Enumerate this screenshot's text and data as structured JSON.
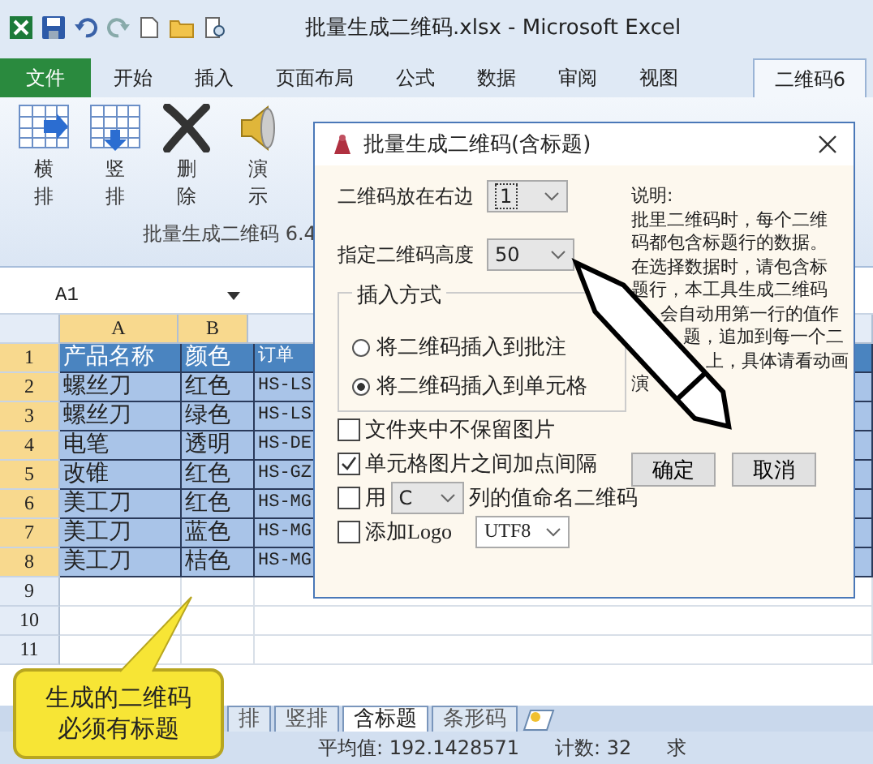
{
  "window": {
    "title": "批量生成二维码.xlsx - Microsoft Excel"
  },
  "ribbon_tabs": [
    {
      "label": "文件",
      "kind": "file",
      "selected": false
    },
    {
      "label": "开始",
      "kind": "tab",
      "selected": false
    },
    {
      "label": "插入",
      "kind": "tab",
      "selected": false
    },
    {
      "label": "页面布局",
      "kind": "tab",
      "selected": false
    },
    {
      "label": "公式",
      "kind": "tab",
      "selected": false
    },
    {
      "label": "数据",
      "kind": "tab",
      "selected": false
    },
    {
      "label": "审阅",
      "kind": "tab",
      "selected": false
    },
    {
      "label": "视图",
      "kind": "tab",
      "selected": false
    },
    {
      "label": "二维码6",
      "kind": "tab",
      "selected": true
    }
  ],
  "ribbon_buttons": [
    {
      "label": "横排",
      "kind": "grid-right"
    },
    {
      "label": "竖排",
      "kind": "grid-down"
    },
    {
      "label": "删除",
      "kind": "cross"
    },
    {
      "label": "演示",
      "kind": "speaker"
    }
  ],
  "ribbon_group": "批量生成二维码 6.4",
  "name_box": "A1",
  "columns": [
    {
      "label": "A",
      "selected": true
    },
    {
      "label": "B",
      "selected": true
    }
  ],
  "rows": [
    {
      "num": "1",
      "kind": "header",
      "cells": [
        "产品名称",
        "颜色",
        "订单"
      ]
    },
    {
      "num": "2",
      "kind": "data",
      "cells": [
        "螺丝刀",
        "红色",
        "HS-LS"
      ]
    },
    {
      "num": "3",
      "kind": "data",
      "cells": [
        "螺丝刀",
        "绿色",
        "HS-LS"
      ]
    },
    {
      "num": "4",
      "kind": "data",
      "cells": [
        "电笔",
        "透明",
        "HS-DE"
      ]
    },
    {
      "num": "5",
      "kind": "data",
      "cells": [
        "改锥",
        "红色",
        "HS-GZ"
      ]
    },
    {
      "num": "6",
      "kind": "data",
      "cells": [
        "美工刀",
        "红色",
        "HS-MG"
      ]
    },
    {
      "num": "7",
      "kind": "data",
      "cells": [
        "美工刀",
        "蓝色",
        "HS-MG"
      ]
    },
    {
      "num": "8",
      "kind": "data",
      "cells": [
        "美工刀",
        "桔色",
        "HS-MG"
      ]
    },
    {
      "num": "9",
      "kind": "empty",
      "cells": []
    },
    {
      "num": "10",
      "kind": "empty",
      "cells": []
    },
    {
      "num": "11",
      "kind": "empty",
      "cells": []
    }
  ],
  "sheet_tabs": [
    {
      "label": "排",
      "selected": false
    },
    {
      "label": "竖排",
      "selected": false
    },
    {
      "label": "含标题",
      "selected": true
    },
    {
      "label": "条形码",
      "selected": false
    }
  ],
  "status_bar": [
    "平均值: 192.1428571",
    "计数: 32",
    "求"
  ],
  "callout": [
    "生成的二维码",
    "必须有标题"
  ],
  "dialog": {
    "title": "批量生成二维码(含标题)",
    "position_label": "二维码放在右边",
    "position_value": "1",
    "height_label": "指定二维码高度",
    "height_value": "50",
    "group_title": "插入方式",
    "radios": [
      {
        "label": "将二维码插入到批注",
        "selected": false
      },
      {
        "label": "将二维码插入到单元格",
        "selected": true
      }
    ],
    "options": [
      {
        "kind": "plain",
        "label": "文件夹中不保留图片",
        "checked": false
      },
      {
        "kind": "plain",
        "label": "单元格图片之间加点间隔",
        "checked": true
      },
      {
        "kind": "column",
        "prefix": "用",
        "value": "C",
        "suffix": "列的值命名二维码",
        "checked": false
      },
      {
        "kind": "logo",
        "label": "添加Logo",
        "value": "UTF8",
        "checked": false
      }
    ],
    "buttons": [
      "确定",
      "取消"
    ],
    "description": [
      "说明:",
      "批里二维码时，每个二维",
      "码都包含标题行的数据。",
      "在选择数据时，请包含标",
      "题行，本工具生成二维码",
      "会自动用第一行的值作",
      "题，追加到每一个二",
      "上，具体请看动画",
      "演"
    ]
  }
}
